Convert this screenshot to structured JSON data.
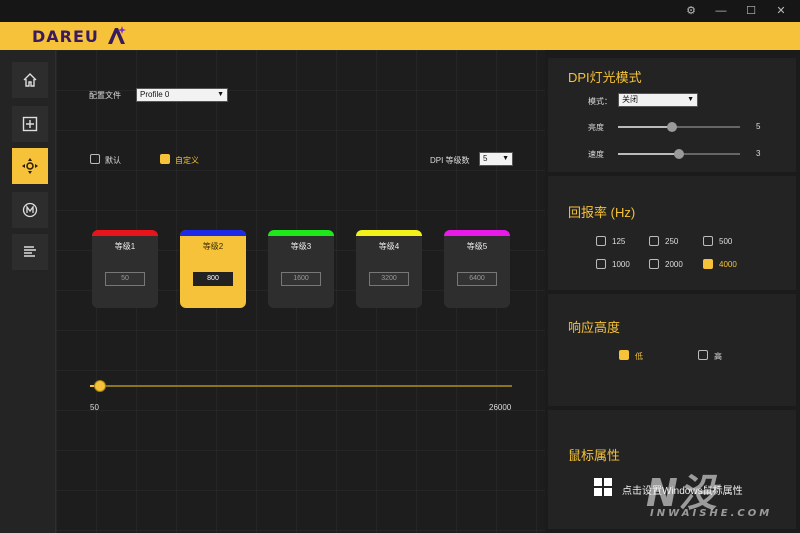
{
  "window": {
    "settings_icon": "gear-icon",
    "minimize_icon": "minimize-icon",
    "maximize_icon": "maximize-icon",
    "close_icon": "close-icon"
  },
  "brand": {
    "logo_text": "DAREU",
    "accent": "#f5c23a",
    "logo_color": "#3a1b5e"
  },
  "sidebar": {
    "items": [
      {
        "name": "home",
        "icon": "home-icon",
        "active": false
      },
      {
        "name": "add",
        "icon": "plus-square-icon",
        "active": false
      },
      {
        "name": "dpi",
        "icon": "crosshair-icon",
        "active": true
      },
      {
        "name": "macro",
        "icon": "m-circle-icon",
        "active": false
      },
      {
        "name": "list",
        "icon": "list-icon",
        "active": false
      }
    ]
  },
  "main": {
    "profile_label": "配置文件",
    "profile_value": "Profile 0",
    "mode_default_label": "默认",
    "mode_custom_label": "自定义",
    "mode_custom_checked": true,
    "dpi_levels_label": "DPI 等级数",
    "dpi_levels_value": "5",
    "levels": [
      {
        "name": "等级1",
        "value": "50",
        "color": "#e8141c",
        "active": false
      },
      {
        "name": "等级2",
        "value": "800",
        "color": "#1a2ae8",
        "active": true
      },
      {
        "name": "等级3",
        "value": "1600",
        "color": "#1ee81a",
        "active": false
      },
      {
        "name": "等级4",
        "value": "3200",
        "color": "#f2f21a",
        "active": false
      },
      {
        "name": "等级5",
        "value": "6400",
        "color": "#e81ae8",
        "active": false
      }
    ],
    "slider_min": "50",
    "slider_max": "26000"
  },
  "lighting": {
    "title": "DPI灯光模式",
    "mode_label": "模式：",
    "mode_value": "关闭",
    "brightness_label": "亮度",
    "brightness_value": "5",
    "speed_label": "速度",
    "speed_value": "3"
  },
  "polling": {
    "title": "回报率 (Hz)",
    "options": [
      {
        "label": "125",
        "checked": false
      },
      {
        "label": "250",
        "checked": false
      },
      {
        "label": "500",
        "checked": false
      },
      {
        "label": "1000",
        "checked": false
      },
      {
        "label": "2000",
        "checked": false
      },
      {
        "label": "4000",
        "checked": true
      }
    ]
  },
  "lod": {
    "title": "响应高度",
    "low_label": "低",
    "high_label": "高",
    "low_checked": true
  },
  "mouse_props": {
    "title": "鼠标属性",
    "link_text": "点击设置Windows鼠标属性"
  },
  "watermark": {
    "text": "N没",
    "sub": "INWAISHE.COM"
  }
}
